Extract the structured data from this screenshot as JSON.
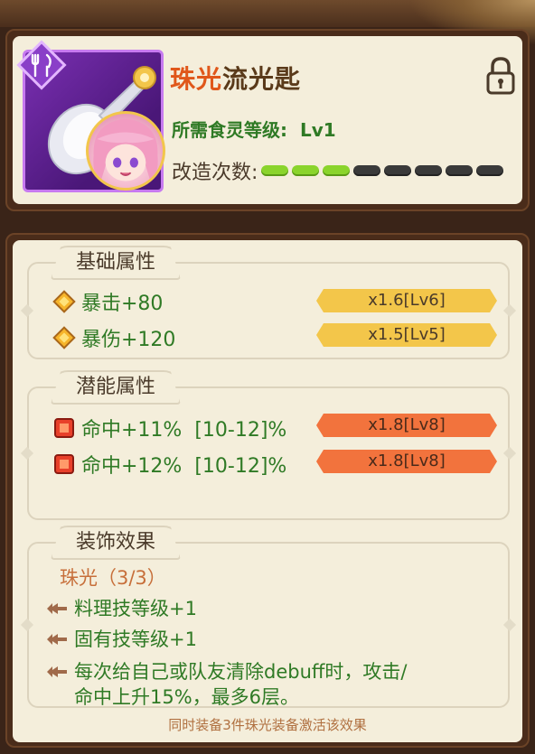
{
  "item": {
    "name_rarity": "珠光",
    "name_rest": "流光匙",
    "required_level_label": "所需食灵等级:",
    "required_level_value": "Lv1",
    "modify_label": "改造次数:",
    "modify_count": 3,
    "modify_max": 8,
    "icons": {
      "badge": "fork-knife-icon",
      "lock": "lock-icon"
    },
    "colors": {
      "rarity": "#e0571a",
      "pip_on": "#8ad42c",
      "pip_off": "#3a3a3a",
      "frame": "#c77af0"
    }
  },
  "basic": {
    "title": "基础属性",
    "stats": [
      {
        "text": "暴击+80",
        "mult": "x1.6[Lv6]"
      },
      {
        "text": "暴伤+120",
        "mult": "x1.5[Lv5]"
      }
    ]
  },
  "potential": {
    "title": "潜能属性",
    "stats": [
      {
        "text": "命中+11%  [10-12]%",
        "mult": "x1.8[Lv8]"
      },
      {
        "text": "命中+12%  [10-12]%",
        "mult": "x1.8[Lv8]"
      }
    ]
  },
  "set": {
    "title": "装饰效果",
    "name": "珠光（3/3）",
    "effects": [
      "料理技等级+1",
      "固有技等级+1",
      "每次给自己或队友清除debuff时，攻击/",
      "命中上升15%，最多6层。"
    ],
    "footer": "同时装备3件珠光装备激活该效果"
  }
}
